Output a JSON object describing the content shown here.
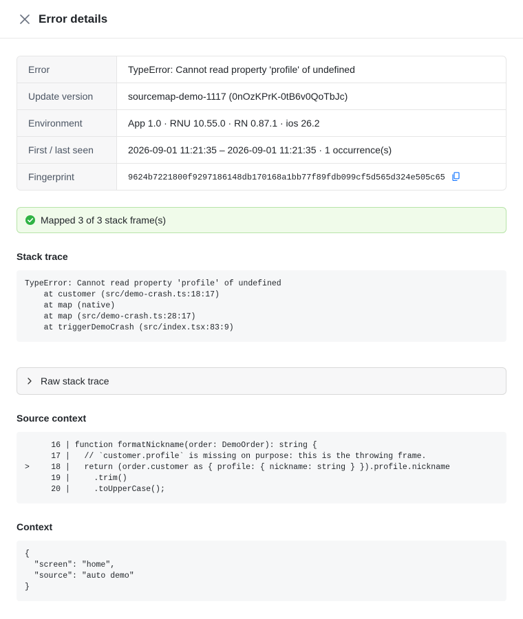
{
  "header": {
    "title": "Error details"
  },
  "details": [
    {
      "key": "Error",
      "value": "TypeError: Cannot read property 'profile' of undefined"
    },
    {
      "key": "Update version",
      "value": "sourcemap-demo-1117 (0nOzKPrK-0tB6v0QoTbJc)"
    },
    {
      "key": "Environment",
      "value": "App 1.0 · RNU 10.55.0 · RN 0.87.1 · ios 26.2"
    },
    {
      "key": "First / last seen",
      "value": "2026-09-01 11:21:35 – 2026-09-01 11:21:35 · 1 occurrence(s)"
    },
    {
      "key": "Fingerprint",
      "value": "9624b7221800f9297186148db170168a1bb77f89fdb099cf5d565d324e505c65"
    }
  ],
  "status": {
    "message": "Mapped 3 of 3 stack frame(s)",
    "color": "#2fb344"
  },
  "stack_trace": {
    "title": "Stack trace",
    "text": "TypeError: Cannot read property 'profile' of undefined\n    at customer (src/demo-crash.ts:18:17)\n    at map (native)\n    at map (src/demo-crash.ts:28:17)\n    at triggerDemoCrash (src/index.tsx:83:9)"
  },
  "raw_stack": {
    "label": "Raw stack trace"
  },
  "source_context": {
    "title": "Source context",
    "lines": [
      {
        "marker": "",
        "num": "16",
        "code": "function formatNickname(order: DemoOrder): string {"
      },
      {
        "marker": "",
        "num": "17",
        "code": "  // `customer.profile` is missing on purpose: this is the throwing frame."
      },
      {
        "marker": ">",
        "num": "18",
        "code": "  return (order.customer as { profile: { nickname: string } }).profile.nickname"
      },
      {
        "marker": "",
        "num": "19",
        "code": "    .trim()"
      },
      {
        "marker": "",
        "num": "20",
        "code": "    .toUpperCase();"
      }
    ]
  },
  "context": {
    "title": "Context",
    "text": "{\n  \"screen\": \"home\",\n  \"source\": \"auto demo\"\n}"
  }
}
